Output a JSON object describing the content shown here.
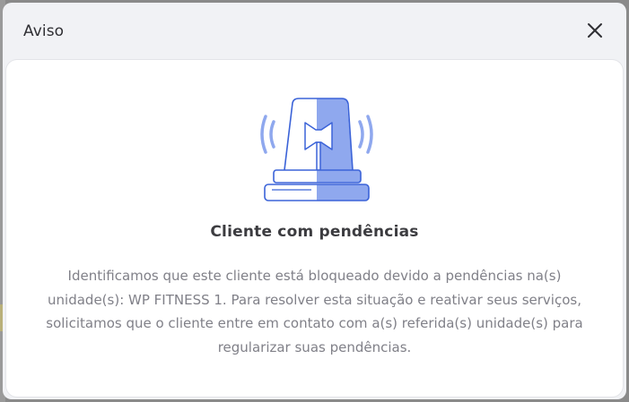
{
  "dialog": {
    "title": "Aviso",
    "close_icon": "close-icon",
    "illustration_icon": "alarm-siren-icon",
    "heading": "Cliente com pendências",
    "message": "Identificamos que este cliente está bloqueado devido a pendências na(s) unidade(s): WP FITNESS 1. Para resolver esta situação e reativar seus serviços, solicitamos que o cliente entre em contato com a(s) referida(s) unidade(s) para regularizar suas pendências."
  },
  "colors": {
    "accent": "#8fa8ee",
    "outline": "#3b63d8",
    "title_text": "#2f2f33",
    "body_text": "#808088"
  }
}
